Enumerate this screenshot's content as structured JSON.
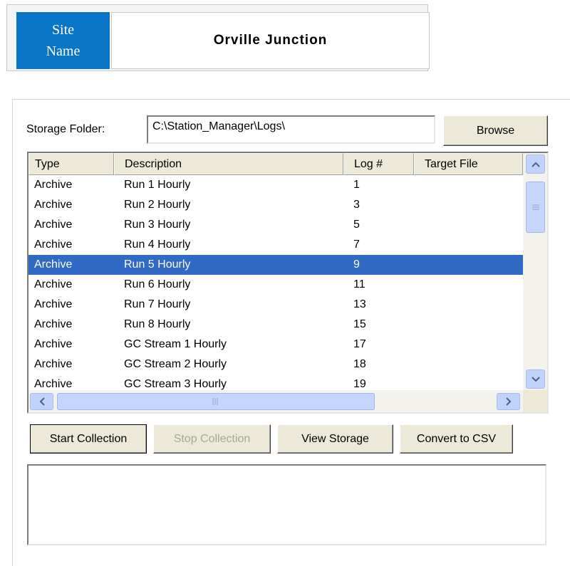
{
  "site": {
    "label": "Site Name",
    "value": "Orville  Junction"
  },
  "storage": {
    "label": "Storage Folder:",
    "path": "C:\\Station_Manager\\Logs\\",
    "browse_label": "Browse"
  },
  "table": {
    "columns": [
      "Type",
      "Description",
      "Log #",
      "Target File"
    ],
    "rows": [
      {
        "type": "Archive",
        "description": "Run 1 Hourly",
        "log": "1",
        "target": ""
      },
      {
        "type": "Archive",
        "description": "Run 2 Hourly",
        "log": "3",
        "target": ""
      },
      {
        "type": "Archive",
        "description": "Run 3 Hourly",
        "log": "5",
        "target": ""
      },
      {
        "type": "Archive",
        "description": "Run 4 Hourly",
        "log": "7",
        "target": ""
      },
      {
        "type": "Archive",
        "description": "Run 5 Hourly",
        "log": "9",
        "target": ""
      },
      {
        "type": "Archive",
        "description": "Run 6 Hourly",
        "log": "11",
        "target": ""
      },
      {
        "type": "Archive",
        "description": "Run 7 Hourly",
        "log": "13",
        "target": ""
      },
      {
        "type": "Archive",
        "description": "Run 8 Hourly",
        "log": "15",
        "target": ""
      },
      {
        "type": "Archive",
        "description": "GC Stream 1 Hourly",
        "log": "17",
        "target": ""
      },
      {
        "type": "Archive",
        "description": "GC Stream 2 Hourly",
        "log": "18",
        "target": ""
      },
      {
        "type": "Archive",
        "description": "GC Stream 3 Hourly",
        "log": "19",
        "target": ""
      }
    ],
    "selected_index": 4
  },
  "buttons": {
    "start": "Start Collection",
    "stop": "Stop Collection",
    "view": "View Storage",
    "csv": "Convert to CSV"
  },
  "status_text": "",
  "icons": {
    "scroll_up": "scroll-up-arrow-icon",
    "scroll_down": "scroll-down-arrow-icon",
    "scroll_left": "scroll-left-arrow-icon",
    "scroll_right": "scroll-right-arrow-icon"
  },
  "colors": {
    "site_label_bg": "#0a75c6",
    "selection": "#316ac5",
    "button_face": "#ece9d8"
  }
}
